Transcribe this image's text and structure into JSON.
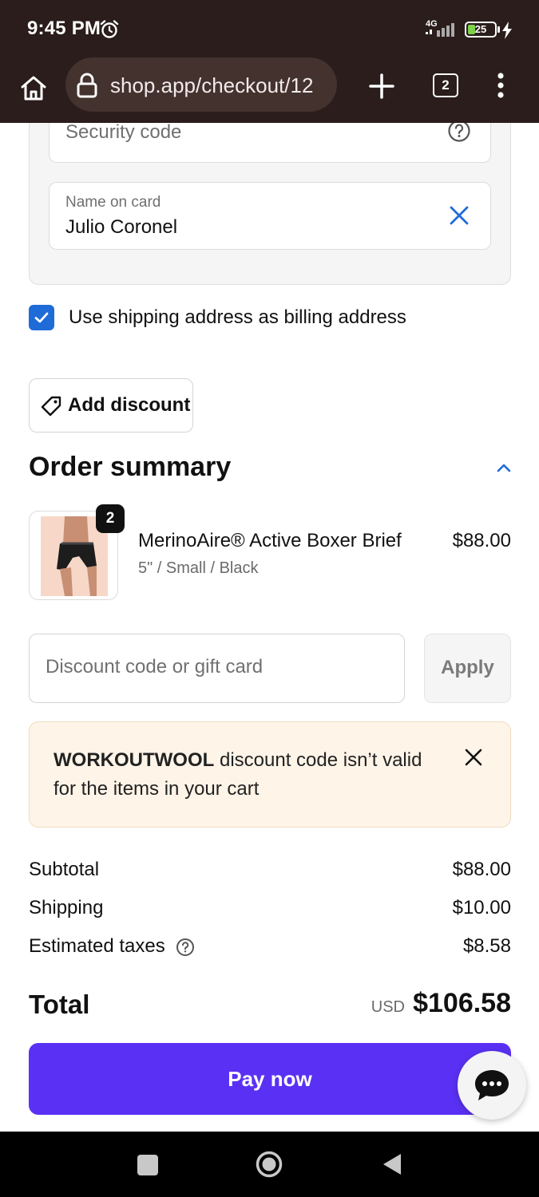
{
  "status_bar": {
    "time": "9:45 PM",
    "network": "4G",
    "battery": "25",
    "battery_level": 0.25
  },
  "browser": {
    "url": "shop.app/checkout/12",
    "tab_count": "2"
  },
  "payment_form": {
    "security_code_placeholder": "Security code",
    "name_label": "Name on card",
    "name_value": "Julio Coronel",
    "billing_checkbox_label": "Use shipping address as billing address",
    "billing_checked": true
  },
  "discount_button_label": "Add discount",
  "order_summary": {
    "title": "Order summary",
    "item": {
      "quantity": "2",
      "name": "MerinoAire® Active Boxer Brief",
      "variant": "5\" / Small / Black",
      "price": "$88.00"
    },
    "code_placeholder": "Discount code or gift card",
    "apply_label": "Apply",
    "alert": {
      "code": "WORKOUTWOOL",
      "message": " discount code isn’t valid for the items in your cart"
    },
    "subtotal_label": "Subtotal",
    "subtotal_value": "$88.00",
    "shipping_label": "Shipping",
    "shipping_value": "$10.00",
    "taxes_label": "Estimated taxes",
    "taxes_value": "$8.58",
    "total_label": "Total",
    "total_currency": "USD",
    "total_value": "$106.58"
  },
  "pay_button_label": "Pay now",
  "colors": {
    "pay_button": "#5a31f4",
    "checkbox": "#1f6bd8",
    "alert_bg": "#fff4e8",
    "browser_bg": "#2a1d1b"
  },
  "icons": [
    "alarm-icon",
    "signal-icon",
    "battery-icon",
    "charging-icon",
    "home-icon",
    "lock-icon",
    "plus-icon",
    "tabs-icon",
    "more-vert-icon",
    "help-icon",
    "close-icon",
    "check-icon",
    "tag-icon",
    "chevron-up-icon",
    "chat-icon"
  ]
}
